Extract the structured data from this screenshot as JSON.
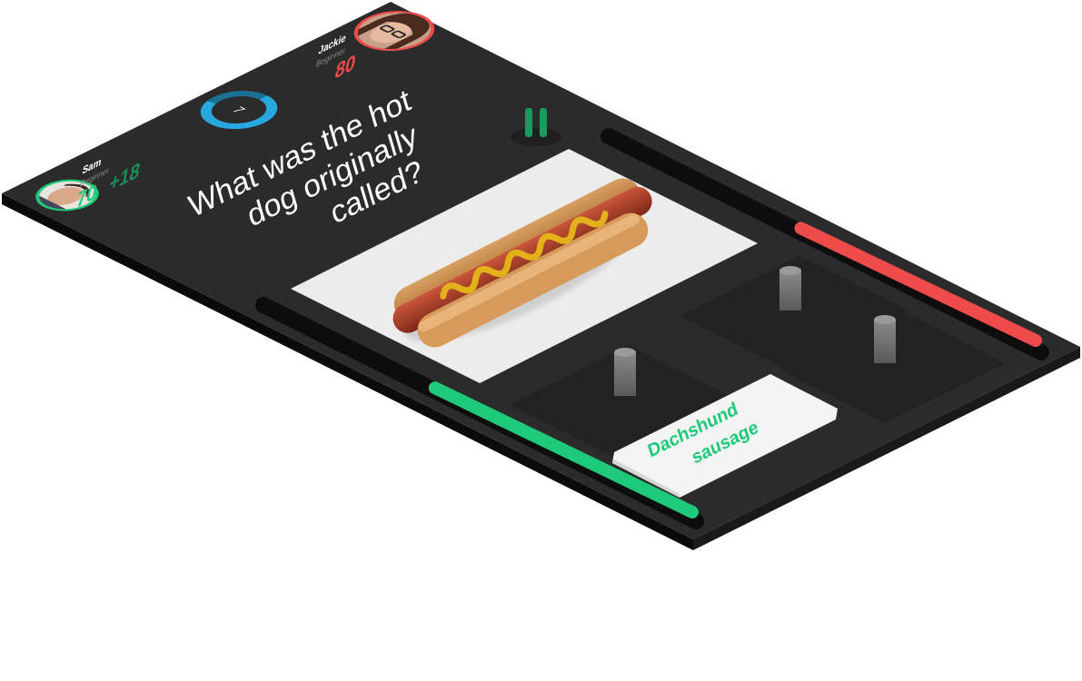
{
  "player_left": {
    "name": "Sam",
    "level": "Beginner",
    "score": "70",
    "bonus": "+18",
    "accent": "#1ec97a"
  },
  "player_right": {
    "name": "Jackie",
    "level": "Beginner",
    "score": "80",
    "accent": "#ef4b4b"
  },
  "round": {
    "number": "7",
    "ring_color": "#29a8e0"
  },
  "question": {
    "lines": [
      "What was the hot",
      "dog originally",
      "called?"
    ]
  },
  "answer": {
    "line1": "Dachshund",
    "line2": "sausage",
    "color": "#1ec97a"
  },
  "progress": {
    "left_fraction": 0.6,
    "right_fraction": 0.55,
    "left_color": "#1ec97a",
    "right_color": "#ef4b4b"
  },
  "icons": {
    "pause": "pause-icon",
    "image": "hot-dog-image"
  },
  "colors": {
    "board": "#2b2b2b",
    "board_side": "#111111",
    "track": "#0d0d0d",
    "answer_slot": "#232323"
  }
}
